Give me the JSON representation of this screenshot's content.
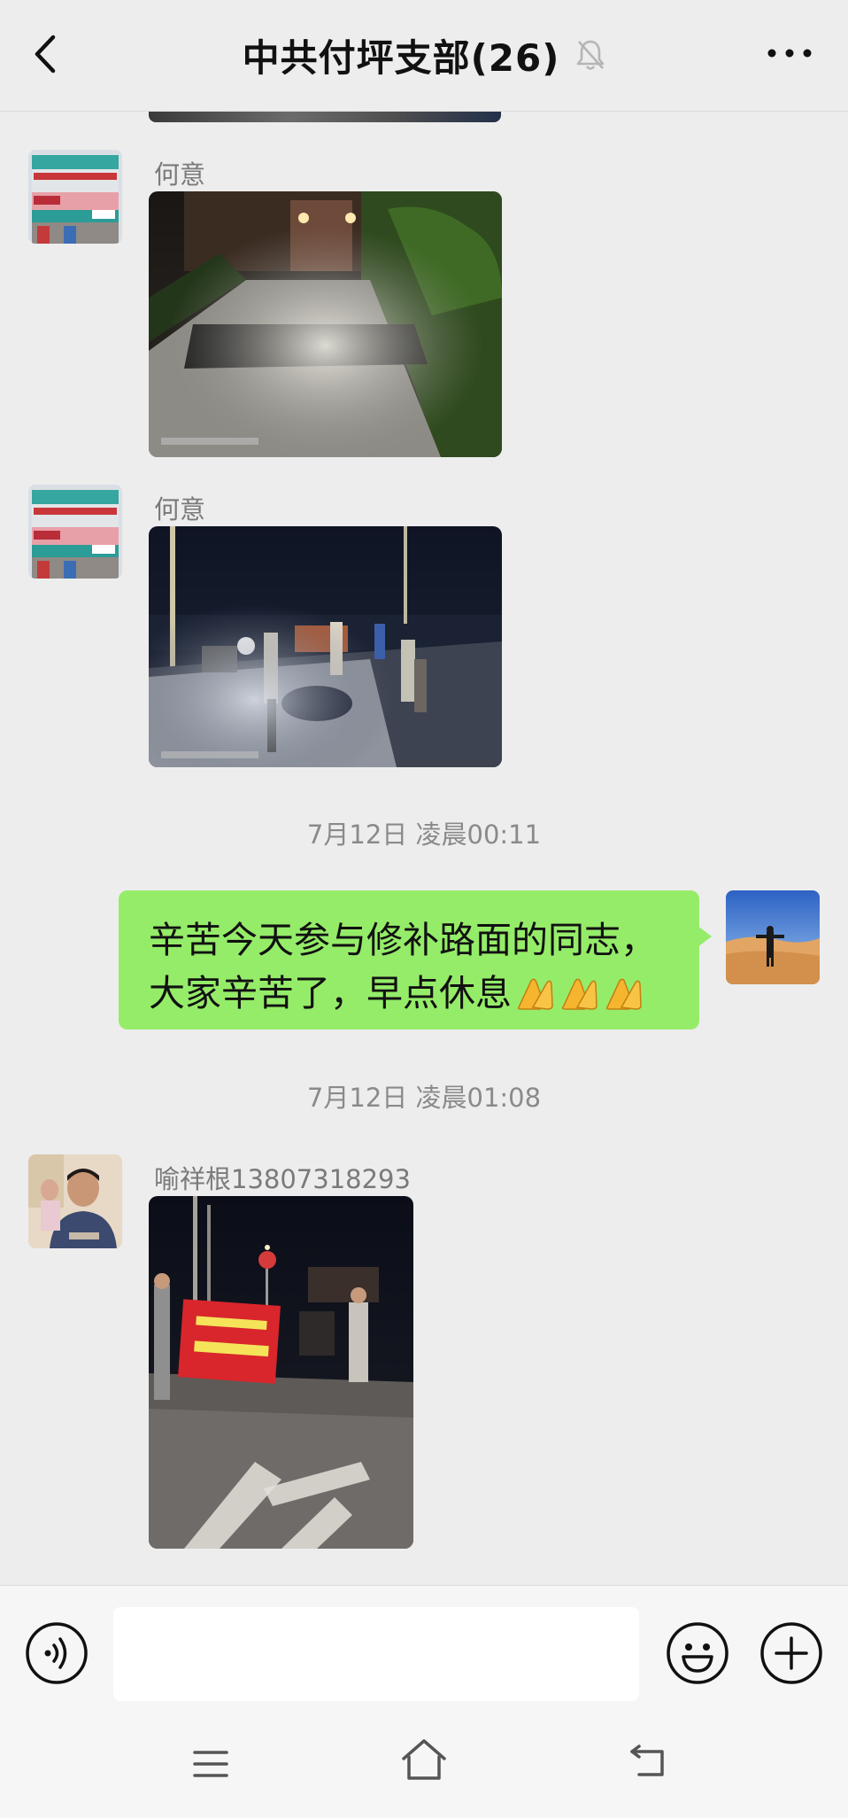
{
  "header": {
    "title": "中共付坪支部(26)",
    "back_icon": "chevron-left-icon",
    "mute_icon": "bell-muted-icon",
    "more_icon": "ellipsis-icon"
  },
  "messages": [
    {
      "sender": "何意",
      "type": "image",
      "image_desc": "road-repair-night-photo"
    },
    {
      "sender": "何意",
      "type": "image",
      "image_desc": "workers-night-photo"
    },
    {
      "type": "timestamp",
      "text": "7月12日 凌晨00:11"
    },
    {
      "type": "text",
      "outgoing": true,
      "lines": [
        "辛苦今天参与修补路面的同志，",
        "大家辛苦了，早点休息"
      ],
      "emoji": "pray-hands x3"
    },
    {
      "type": "timestamp",
      "text": "7月12日 凌晨01:08"
    },
    {
      "sender": "喻祥根13807318293",
      "type": "image",
      "image_desc": "group-with-red-banner-photo"
    }
  ],
  "input_bar": {
    "placeholder": "",
    "voice_icon": "voice-icon",
    "emoji_icon": "smiley-icon",
    "plus_icon": "plus-circle-icon"
  },
  "system_nav": {
    "menu_icon": "menu-icon",
    "home_icon": "home-icon",
    "back_icon": "back-arrow-icon"
  },
  "colors": {
    "background": "#ededed",
    "bubble_outgoing": "#95ec69",
    "sender_text": "#7a7a7a",
    "timestamp_text": "#8a8a8a"
  }
}
